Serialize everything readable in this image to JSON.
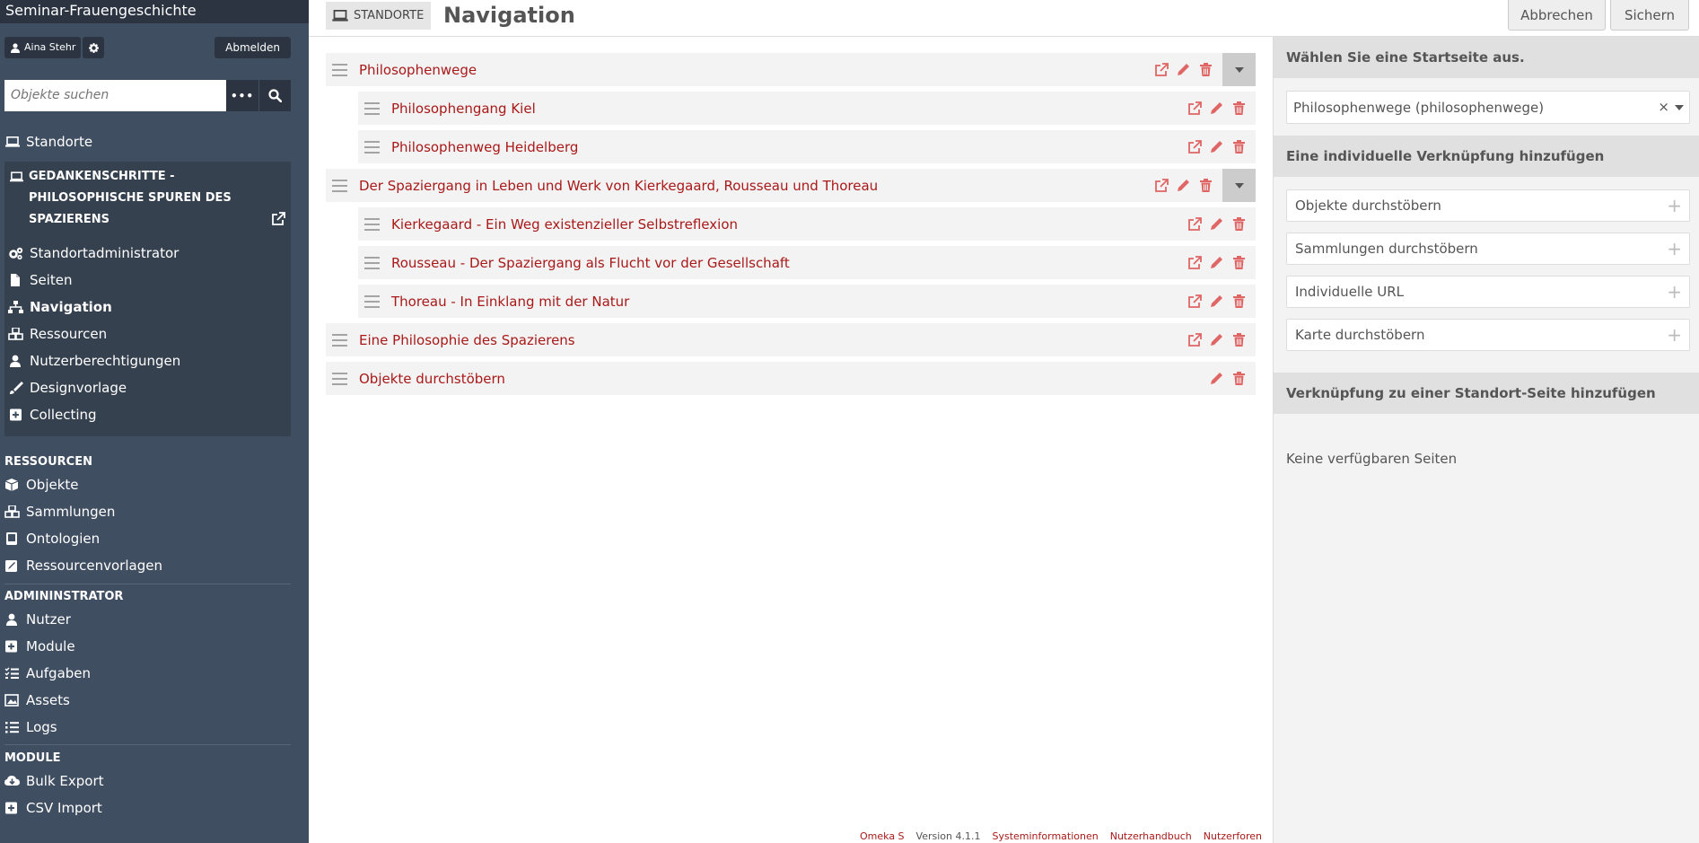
{
  "sidebar": {
    "site_title": "Seminar-Frauengeschichte",
    "user_name": "Aina Stehr",
    "logout_label": "Abmelden",
    "search_placeholder": "Objekte suchen",
    "search_options_label": "•••",
    "standorte_label": "Standorte",
    "site_name": "GEDANKENSCHRITTE - PHILOSOPHISCHE SPUREN DES SPAZIERENS",
    "site_nav": [
      {
        "label": "Standortadministrator",
        "icon": "cogs-icon"
      },
      {
        "label": "Seiten",
        "icon": "file-icon"
      },
      {
        "label": "Navigation",
        "icon": "sitemap-icon",
        "active": true
      },
      {
        "label": "Ressourcen",
        "icon": "cubes-icon"
      },
      {
        "label": "Nutzerberechtigungen",
        "icon": "user-icon"
      },
      {
        "label": "Designvorlage",
        "icon": "brush-icon"
      },
      {
        "label": "Collecting",
        "icon": "plus-square-icon"
      }
    ],
    "section_resources": "RESSOURCEN",
    "resources": [
      {
        "label": "Objekte",
        "icon": "cube-icon"
      },
      {
        "label": "Sammlungen",
        "icon": "cubes-icon"
      },
      {
        "label": "Ontologien",
        "icon": "book-icon"
      },
      {
        "label": "Ressourcenvorlagen",
        "icon": "edit-square-icon"
      }
    ],
    "section_admin": "ADMININSTRATOR",
    "admin": [
      {
        "label": "Nutzer",
        "icon": "user-icon"
      },
      {
        "label": "Module",
        "icon": "plus-square-icon"
      },
      {
        "label": "Aufgaben",
        "icon": "tasks-icon"
      },
      {
        "label": "Assets",
        "icon": "image-icon"
      },
      {
        "label": "Logs",
        "icon": "list-icon"
      }
    ],
    "section_modules": "MODULE",
    "modules": [
      {
        "label": "Bulk Export",
        "icon": "cloud-download-icon"
      },
      {
        "label": "CSV Import",
        "icon": "plus-square-icon"
      }
    ]
  },
  "header": {
    "breadcrumb": "STANDORTE",
    "title": "Navigation",
    "cancel_label": "Abbrechen",
    "save_label": "Sichern"
  },
  "tree": [
    {
      "label": "Philosophenwege",
      "level": 0,
      "link": true,
      "toggle": true
    },
    {
      "label": "Philosophengang Kiel",
      "level": 1,
      "link": true,
      "toggle": false
    },
    {
      "label": "Philosophenweg Heidelberg",
      "level": 1,
      "link": true,
      "toggle": false
    },
    {
      "label": "Der Spaziergang in Leben und Werk von Kierkegaard, Rousseau und Thoreau",
      "level": 0,
      "link": true,
      "toggle": true
    },
    {
      "label": "Kierkegaard - Ein Weg existenzieller Selbstreflexion",
      "level": 1,
      "link": true,
      "toggle": false
    },
    {
      "label": "Rousseau - Der Spaziergang als Flucht vor der Gesellschaft",
      "level": 1,
      "link": true,
      "toggle": false
    },
    {
      "label": "Thoreau - In Einklang mit der Natur",
      "level": 1,
      "link": true,
      "toggle": false
    },
    {
      "label": "Eine Philosophie des Spazierens",
      "level": 0,
      "link": true,
      "toggle": false
    },
    {
      "label": "Objekte durchstöbern",
      "level": 0,
      "link": false,
      "toggle": false
    }
  ],
  "right_panel": {
    "homepage_heading": "Wählen Sie eine Startseite aus.",
    "homepage_value": "Philosophenwege (philosophenwege)",
    "clear_symbol": "×",
    "custom_heading": "Eine individuelle Verknüpfung hinzufügen",
    "custom_options": [
      "Objekte durchstöbern",
      "Sammlungen durchstöbern",
      "Individuelle URL",
      "Karte durchstöbern"
    ],
    "plus_symbol": "+",
    "site_page_heading": "Verknüpfung zu einer Standort-Seite hinzufügen",
    "no_pages": "Keine verfügbaren Seiten"
  },
  "footer": {
    "brand": "Omeka S",
    "version": "Version 4.1.1",
    "system_info": "Systeminformationen",
    "manual": "Nutzerhandbuch",
    "forums": "Nutzerforen"
  },
  "colors": {
    "sidebar_bg": "#404e61",
    "sidebar_dark": "#2b3440",
    "link_red": "#a91919",
    "action_red": "#e06565"
  }
}
